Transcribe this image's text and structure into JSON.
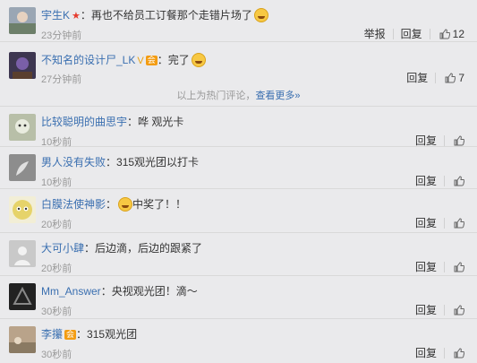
{
  "comments": [
    {
      "user": "宇生K",
      "badge": "★",
      "badge_color": "#e63b2e",
      "text": "再也不给员工订餐那个走错片场了",
      "emoji": "laughing-tears",
      "time": "23分钟前",
      "report": "举报",
      "reply": "回复",
      "likes": "12",
      "avatar_color": "#9aa6b4"
    },
    {
      "user": "不知名的设计尸_LK",
      "badge": "V",
      "badge_color": "#e8a317",
      "vip": "会",
      "text": "完了",
      "emoji": "fingers-to-mouth",
      "time": "27分钟前",
      "reply": "回复",
      "likes": "7",
      "avatar_color": "#3d3650"
    },
    {
      "user": "比较聪明的曲思宇",
      "text": "哗 观光卡",
      "time": "10秒前",
      "reply": "回复",
      "avatar_color": "#b8bfa8"
    },
    {
      "user": "男人没有失败",
      "text": "315观光团以打卡",
      "time": "10秒前",
      "reply": "回复",
      "avatar_color": "#8d8d8d"
    },
    {
      "user": "白膜法使神影",
      "text": "中奖了！！",
      "emoji_before": "laughing-tears",
      "time": "20秒前",
      "reply": "回复",
      "avatar_color": "#e6d36a"
    },
    {
      "user": "大可小肆",
      "text": "后边滴，后边的跟紧了",
      "time": "20秒前",
      "reply": "回复",
      "avatar_color": "#c9c9c9"
    },
    {
      "user": "Mm_Answer",
      "text": "央视观光团！滴～",
      "time": "30秒前",
      "reply": "回复",
      "avatar_color": "#222222"
    },
    {
      "user": "李攥",
      "vip": "会",
      "text": "315观光团",
      "time": "30秒前",
      "reply": "回复",
      "avatar_color": "#b9a38a"
    }
  ],
  "hot_notice": {
    "text": "以上为热门评论，",
    "more": "查看更多»"
  }
}
